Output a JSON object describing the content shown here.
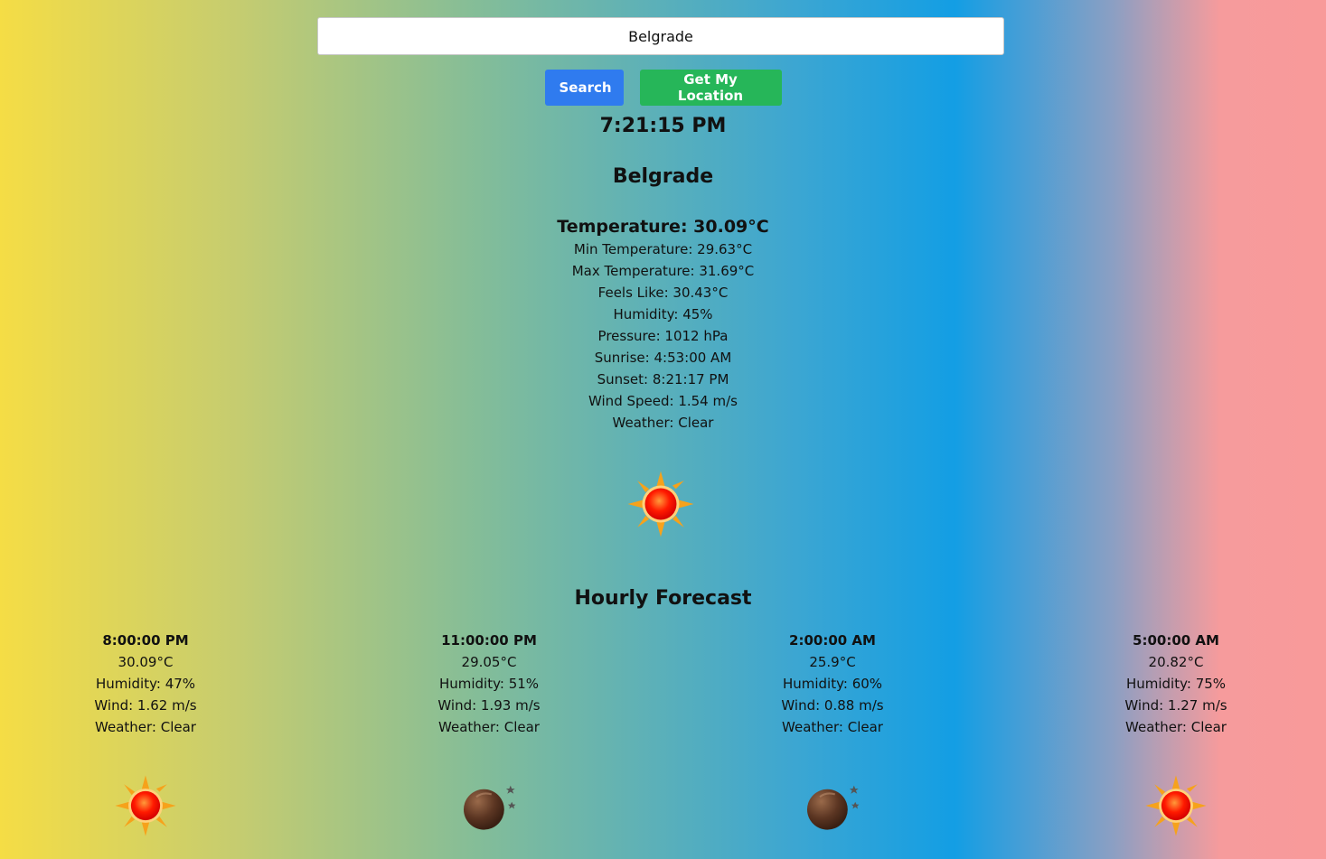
{
  "search": {
    "value": "Belgrade",
    "search_label": "Search",
    "location_label": "Get My Location"
  },
  "clock": "7:21:15 PM",
  "current": {
    "city": "Belgrade",
    "temperature": "Temperature: 30.09°C",
    "details": [
      "Min Temperature: 29.63°C",
      "Max Temperature: 31.69°C",
      "Feels Like: 30.43°C",
      "Humidity: 45%",
      "Pressure: 1012 hPa",
      "Sunrise: 4:53:00 AM",
      "Sunset: 8:21:17 PM",
      "Wind Speed: 1.54 m/s",
      "Weather: Clear"
    ],
    "icon": "sun-icon"
  },
  "hourly": {
    "title": "Hourly Forecast",
    "items": [
      {
        "time": "8:00:00 PM",
        "temp": "30.09°C",
        "humidity": "Humidity: 47%",
        "wind": "Wind: 1.62 m/s",
        "weather": "Weather: Clear",
        "icon": "sun-icon"
      },
      {
        "time": "11:00:00 PM",
        "temp": "29.05°C",
        "humidity": "Humidity: 51%",
        "wind": "Wind: 1.93 m/s",
        "weather": "Weather: Clear",
        "icon": "moon-icon"
      },
      {
        "time": "2:00:00 AM",
        "temp": "25.9°C",
        "humidity": "Humidity: 60%",
        "wind": "Wind: 0.88 m/s",
        "weather": "Weather: Clear",
        "icon": "moon-icon"
      },
      {
        "time": "5:00:00 AM",
        "temp": "20.82°C",
        "humidity": "Humidity: 75%",
        "wind": "Wind: 1.27 m/s",
        "weather": "Weather: Clear",
        "icon": "sun-icon"
      }
    ]
  }
}
